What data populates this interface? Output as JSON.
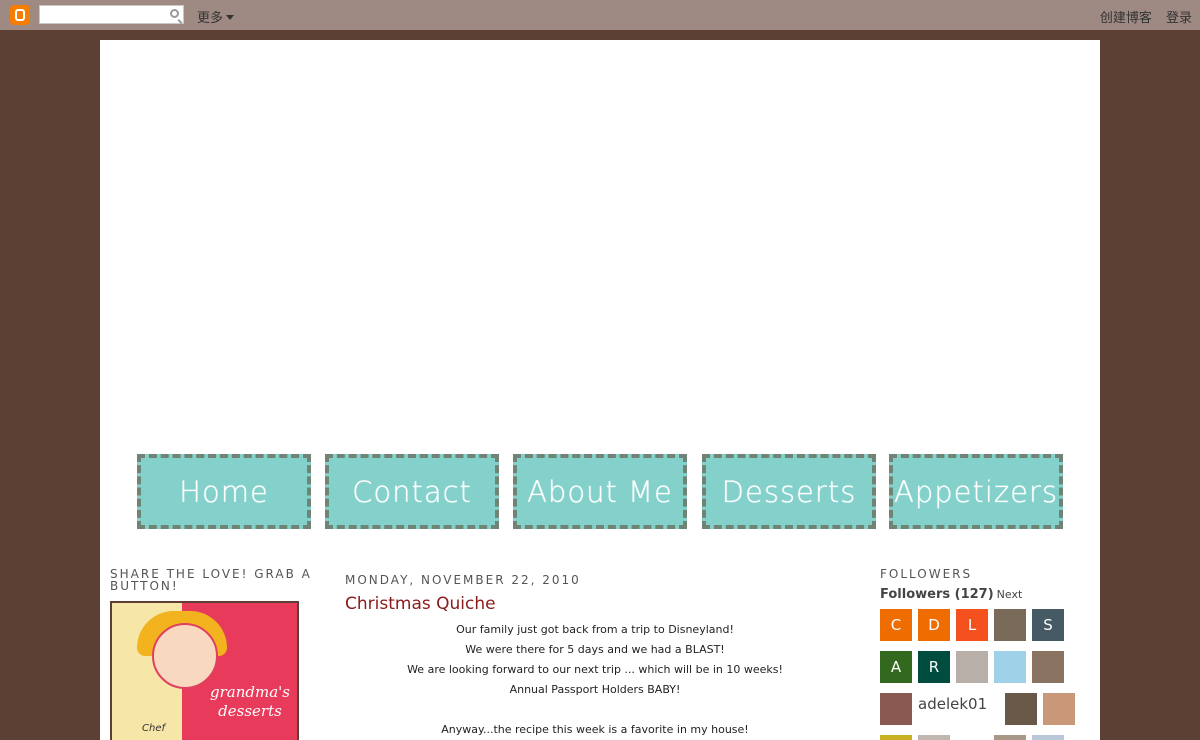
{
  "navbar": {
    "more_label": "更多",
    "create_blog": "创建博客",
    "login": "登录"
  },
  "nav_buttons": [
    "Home",
    "Contact",
    "About Me",
    "Desserts",
    "Appetizers"
  ],
  "left_sidebar": {
    "title": "SHARE THE LOVE! GRAB A BUTTON!",
    "button_text": "grandma's desserts",
    "chef_label": "Chef"
  },
  "post": {
    "date": "MONDAY, NOVEMBER 22, 2010",
    "title": "Christmas Quiche",
    "lines": [
      "Our family just got back from a trip to Disneyland!",
      "We were there for 5 days and we had a BLAST!",
      "We are looking forward to our next trip ... which will be in 10 weeks!",
      "Annual Passport Holders BABY!",
      "",
      "Anyway...the recipe this week is a favorite in my house!"
    ]
  },
  "followers": {
    "title": "FOLLOWERS",
    "count_label": "Followers (127)",
    "next_label": "Next",
    "row1": [
      {
        "letter": "C",
        "color": "#ef6c00"
      },
      {
        "letter": "D",
        "color": "#ef6c00"
      },
      {
        "letter": "L",
        "color": "#f4511e"
      },
      {
        "letter": "",
        "color": "#7a6a5a"
      },
      {
        "letter": "S",
        "color": "#455a64"
      }
    ],
    "row2": [
      {
        "letter": "A",
        "color": "#33691e"
      },
      {
        "letter": "R",
        "color": "#004d40"
      },
      {
        "letter": "",
        "color": "#b8b0a8"
      },
      {
        "letter": "",
        "color": "#9fd2e8"
      },
      {
        "letter": "",
        "color": "#8a7360"
      }
    ],
    "broken_image_alt": "adelek01"
  }
}
